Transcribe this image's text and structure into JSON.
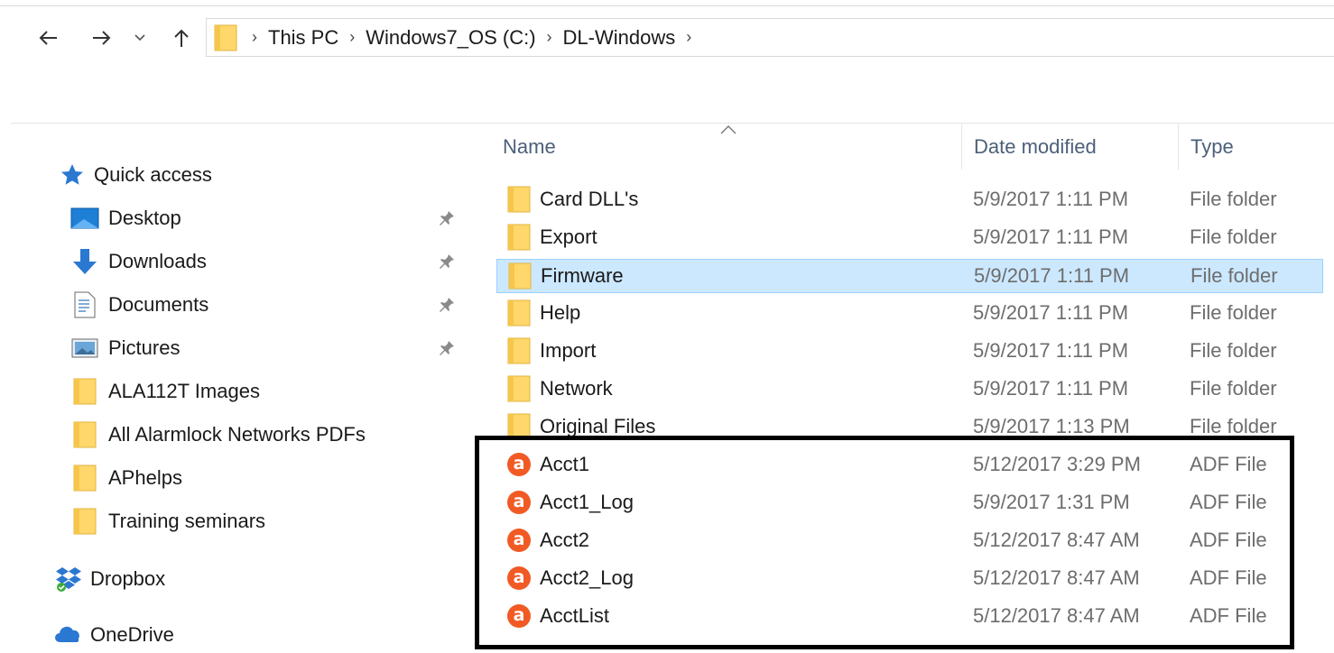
{
  "navigation": {
    "back_icon": "arrow-left-icon",
    "forward_icon": "arrow-right-icon",
    "recent_icon": "chevron-down-icon",
    "up_icon": "arrow-up-icon"
  },
  "address_bar": {
    "root_icon": "folder-icon",
    "breadcrumbs": [
      "This PC",
      "Windows7_OS (C:)",
      "DL-Windows"
    ]
  },
  "sidebar": {
    "quick_access": {
      "label": "Quick access",
      "icon": "star-icon"
    },
    "items": [
      {
        "label": "Desktop",
        "icon": "desktop-icon",
        "pinned": true
      },
      {
        "label": "Downloads",
        "icon": "download-icon",
        "pinned": true
      },
      {
        "label": "Documents",
        "icon": "document-icon",
        "pinned": true
      },
      {
        "label": "Pictures",
        "icon": "pictures-icon",
        "pinned": true
      },
      {
        "label": "ALA112T Images",
        "icon": "folder-icon",
        "pinned": false
      },
      {
        "label": "All Alarmlock Networks PDFs",
        "icon": "folder-icon",
        "pinned": false
      },
      {
        "label": "APhelps",
        "icon": "folder-icon",
        "pinned": false
      },
      {
        "label": "Training seminars",
        "icon": "folder-icon",
        "pinned": false
      }
    ],
    "dropbox": {
      "label": "Dropbox",
      "icon": "dropbox-icon"
    },
    "onedrive": {
      "label": "OneDrive",
      "icon": "onedrive-icon"
    }
  },
  "file_list": {
    "columns": {
      "name": "Name",
      "date": "Date modified",
      "type": "Type"
    },
    "sort_column": "Name",
    "rows": [
      {
        "name": "Card DLL's",
        "date": "5/9/2017 1:11 PM",
        "type": "File folder",
        "icon": "folder-icon",
        "selected": false
      },
      {
        "name": "Export",
        "date": "5/9/2017 1:11 PM",
        "type": "File folder",
        "icon": "folder-icon",
        "selected": false
      },
      {
        "name": "Firmware",
        "date": "5/9/2017 1:11 PM",
        "type": "File folder",
        "icon": "folder-icon",
        "selected": true
      },
      {
        "name": "Help",
        "date": "5/9/2017 1:11 PM",
        "type": "File folder",
        "icon": "folder-icon",
        "selected": false
      },
      {
        "name": "Import",
        "date": "5/9/2017 1:11 PM",
        "type": "File folder",
        "icon": "folder-icon",
        "selected": false
      },
      {
        "name": "Network",
        "date": "5/9/2017 1:11 PM",
        "type": "File folder",
        "icon": "folder-icon",
        "selected": false
      },
      {
        "name": "Original Files",
        "date": "5/9/2017 1:13 PM",
        "type": "File folder",
        "icon": "folder-icon",
        "selected": false
      },
      {
        "name": "Acct1",
        "date": "5/12/2017 3:29 PM",
        "type": "ADF File",
        "icon": "adf-file-icon",
        "selected": false
      },
      {
        "name": "Acct1_Log",
        "date": "5/9/2017 1:31 PM",
        "type": "ADF File",
        "icon": "adf-file-icon",
        "selected": false
      },
      {
        "name": "Acct2",
        "date": "5/12/2017 8:47 AM",
        "type": "ADF File",
        "icon": "adf-file-icon",
        "selected": false
      },
      {
        "name": "Acct2_Log",
        "date": "5/12/2017 8:47 AM",
        "type": "ADF File",
        "icon": "adf-file-icon",
        "selected": false
      },
      {
        "name": "AcctList",
        "date": "5/12/2017 8:47 AM",
        "type": "ADF File",
        "icon": "adf-file-icon",
        "selected": false
      }
    ]
  },
  "colors": {
    "selection_bg": "#cce8ff",
    "selection_border": "#99d1ff",
    "folder_yellow": "#ffd76a",
    "adf_orange": "#f15a24",
    "annotation_border": "#000000"
  }
}
